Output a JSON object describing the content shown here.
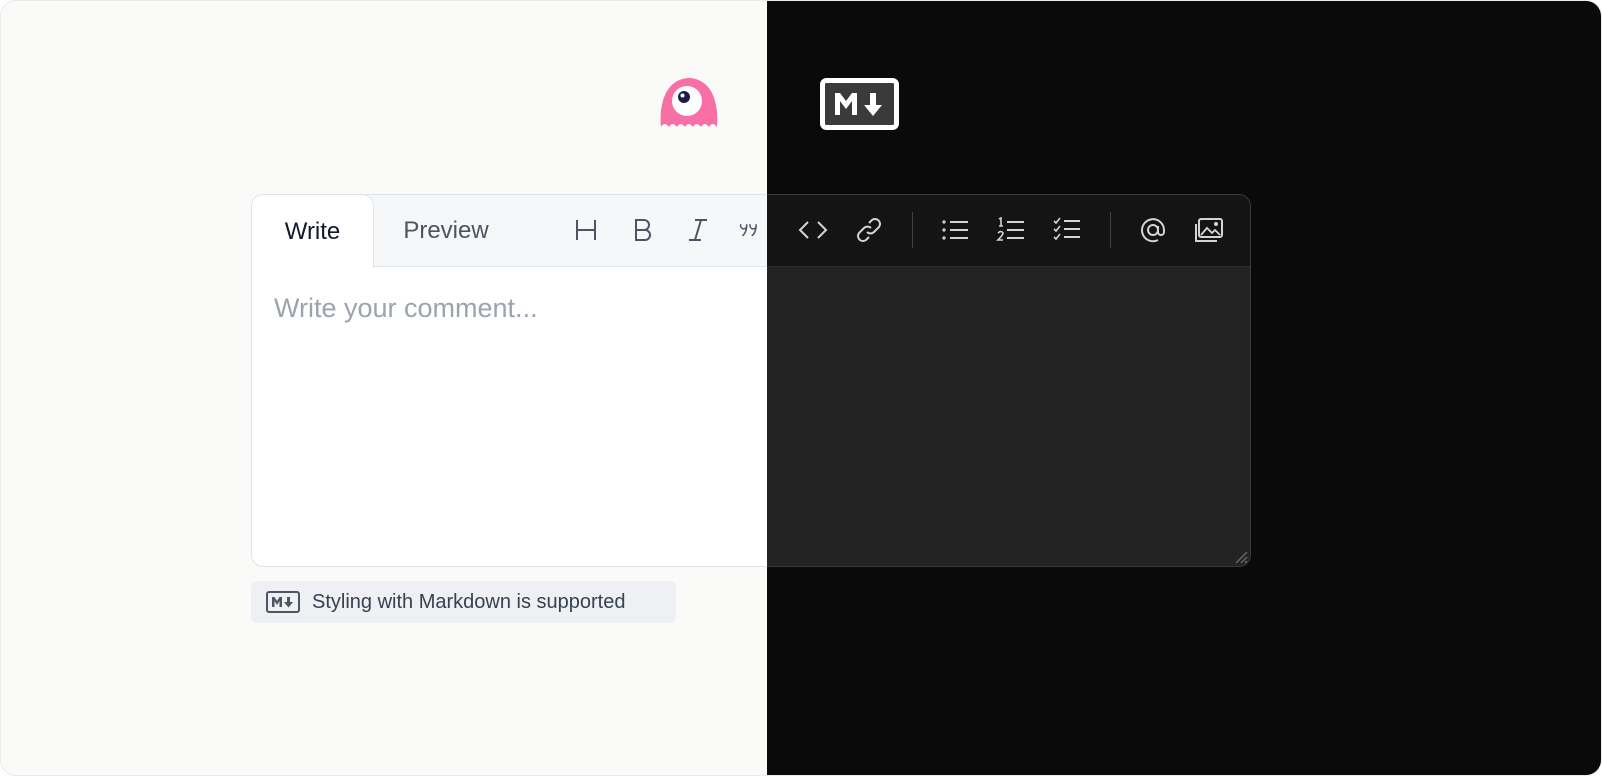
{
  "logos": {
    "mascot_icon": "pink-mascot-icon",
    "markdown_icon": "markdown-icon"
  },
  "editor": {
    "tabs": [
      {
        "label": "Write",
        "active": true
      },
      {
        "label": "Preview",
        "active": false
      }
    ],
    "placeholder": "Write your comment...",
    "toolbar": [
      {
        "name": "heading-icon",
        "title": "Heading"
      },
      {
        "name": "bold-icon",
        "title": "Bold"
      },
      {
        "name": "italic-icon",
        "title": "Italic"
      },
      {
        "name": "quote-icon",
        "title": "Quote"
      },
      {
        "name": "code-icon",
        "title": "Code"
      },
      {
        "name": "link-icon",
        "title": "Link"
      },
      {
        "name": "bullet-list-icon",
        "title": "Bulleted list"
      },
      {
        "name": "numbered-list-icon",
        "title": "Numbered list"
      },
      {
        "name": "task-list-icon",
        "title": "Task list"
      },
      {
        "name": "mention-icon",
        "title": "Mention"
      },
      {
        "name": "image-icon",
        "title": "Image"
      }
    ]
  },
  "footer": {
    "markdown_hint": "Styling with Markdown is supported"
  },
  "colors": {
    "light_bg": "#fafaf9",
    "dark_bg": "#0a0a0a",
    "mascot_pink": "#f86fa6"
  }
}
